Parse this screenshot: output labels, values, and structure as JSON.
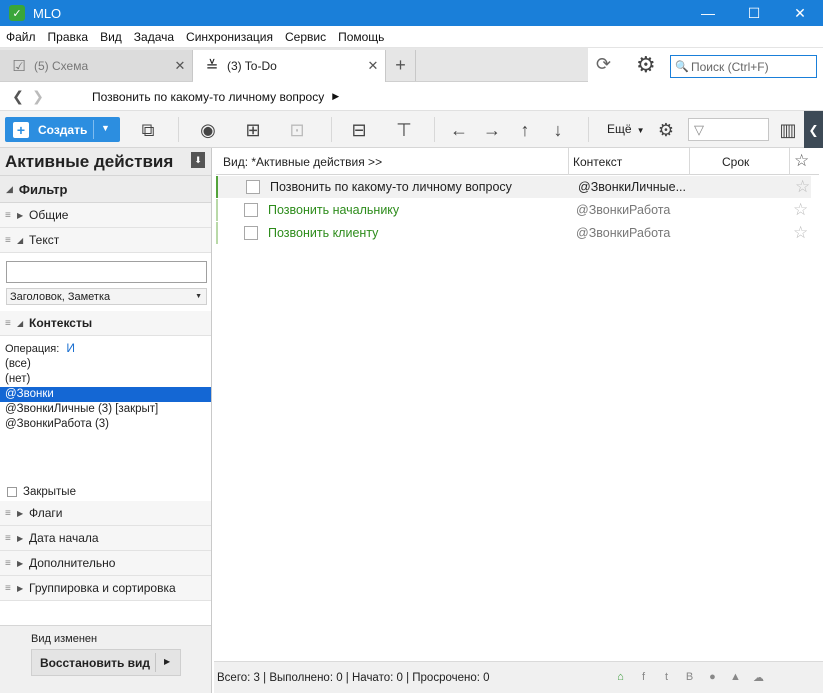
{
  "window": {
    "title": "MLO",
    "controls": {
      "minimize": "—",
      "maximize": "☐",
      "close": "✕"
    }
  },
  "menu": [
    "Файл",
    "Правка",
    "Вид",
    "Задача",
    "Синхронизация",
    "Сервис",
    "Помощь"
  ],
  "tabs": [
    {
      "label": "(5) Схема",
      "active": false,
      "icon": "checklist-icon"
    },
    {
      "label": "(3) To-Do",
      "active": true,
      "icon": "todo-icon"
    }
  ],
  "search": {
    "placeholder": "Поиск (Ctrl+F)"
  },
  "breadcrumb": {
    "text": "Позвонить по какому-то личному вопросу"
  },
  "toolbar": {
    "create_label": "Создать",
    "more_label": "Ещё"
  },
  "left_panel": {
    "title": "Активные действия",
    "filter_label": "Фильтр",
    "sections": {
      "general": "Общие",
      "text": "Текст",
      "contexts": "Контексты",
      "flags": "Флаги",
      "start_date": "Дата начала",
      "additional": "Дополнительно",
      "grouping": "Группировка и сортировка"
    },
    "text_input_value": "",
    "text_scope": "Заголовок, Заметка",
    "operation_label": "Операция:",
    "operation_value": "И",
    "contexts": [
      {
        "label": "(все)",
        "selected": false
      },
      {
        "label": "(нет)",
        "selected": false
      },
      {
        "label": "@Звонки",
        "selected": true
      },
      {
        "label": "@ЗвонкиЛичные (3) [закрыт]",
        "selected": false
      },
      {
        "label": "@ЗвонкиРабота (3)",
        "selected": false
      }
    ],
    "closed_label": "Закрытые",
    "view_changed": "Вид изменен",
    "restore_label": "Восстановить вид"
  },
  "list": {
    "view_label": "Вид: *Активные действия >>",
    "columns": {
      "context": "Контекст",
      "due": "Срок"
    },
    "tasks": [
      {
        "title": "Позвонить по какому-то личному вопросу",
        "context": "@ЗвонкиЛичные...",
        "due": ""
      },
      {
        "title": "Позвонить начальнику",
        "context": "@ЗвонкиРабота",
        "due": ""
      },
      {
        "title": "Позвонить клиенту",
        "context": "@ЗвонкиРабота",
        "due": ""
      }
    ]
  },
  "status": {
    "text": "Всего: 3 | Выполнено: 0 | Начато: 0 | Просрочено: 0"
  },
  "colors": {
    "titlebar": "#1a7fd9",
    "accent": "#2c8ee0",
    "selection": "#1467d4",
    "task_green": "#2d8c1b"
  }
}
